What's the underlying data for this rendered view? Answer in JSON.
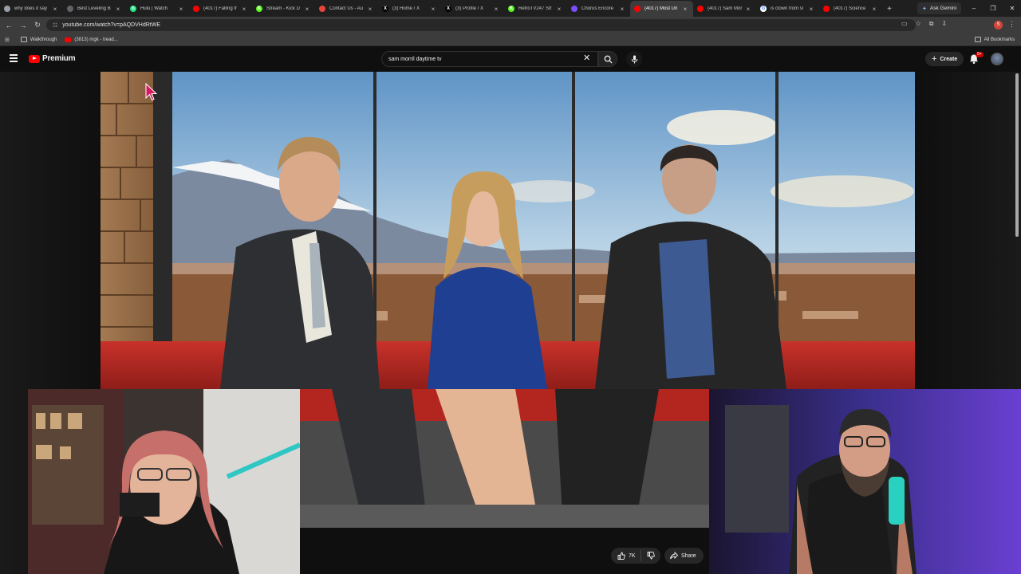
{
  "tabs": [
    {
      "title": "why does it say",
      "favicon_color": "#9aa0a6",
      "favicon_glyph": "",
      "active": false
    },
    {
      "title": "Best Leveling B",
      "favicon_color": "#5f6368",
      "favicon_glyph": "",
      "active": false
    },
    {
      "title": "Hulu | Watch",
      "favicon_color": "#1ce783",
      "favicon_glyph": "h",
      "active": false
    },
    {
      "title": "(4017) Falling fr",
      "favicon_color": "#ff0000",
      "favicon_glyph": "",
      "active": false
    },
    {
      "title": "Stream - Kick D",
      "favicon_color": "#53fc18",
      "favicon_glyph": "K",
      "active": false
    },
    {
      "title": "Contact Us - Au",
      "favicon_color": "#e8453c",
      "favicon_glyph": "",
      "active": false
    },
    {
      "title": "(3) Home / X",
      "favicon_color": "#000000",
      "favicon_glyph": "X",
      "active": false
    },
    {
      "title": "(3) Profile / X",
      "favicon_color": "#000000",
      "favicon_glyph": "X",
      "active": false
    },
    {
      "title": "RetroTV247 Str",
      "favicon_color": "#53fc18",
      "favicon_glyph": "K",
      "active": false
    },
    {
      "title": "Chorus Encore",
      "favicon_color": "#7c4dff",
      "favicon_glyph": "",
      "active": false
    },
    {
      "title": "(4017) Most Un",
      "favicon_color": "#ff0000",
      "favicon_glyph": "",
      "active": true
    },
    {
      "title": "(4017) Sam Mor",
      "favicon_color": "#ff0000",
      "favicon_glyph": "",
      "active": false
    },
    {
      "title": "is clown from sl",
      "favicon_color": "#ffffff",
      "favicon_glyph": "G",
      "active": false
    },
    {
      "title": "(4017) Science",
      "favicon_color": "#ff0000",
      "favicon_glyph": "",
      "active": false
    }
  ],
  "tab_close_glyph": "×",
  "new_tab_glyph": "+",
  "gemini_label": "Ask Gemini",
  "window_controls": {
    "minimize": "–",
    "maximize": "❐",
    "close": "✕"
  },
  "address": {
    "url": "youtube.com/watch?v=pAQDVHdRtWE"
  },
  "profile_initial": "S",
  "bookmarks": {
    "items": [
      {
        "label": "Walkthrough",
        "icon": "folder-icon"
      },
      {
        "label": "(3813) mgk - tread...",
        "icon": "youtube-icon"
      }
    ],
    "all_label": "All Bookmarks"
  },
  "youtube": {
    "logo_text": "Premium",
    "search_value": "sam morril daytime tv",
    "create_label": "Create",
    "notification_count": "9+",
    "actions": {
      "like_count": "7K",
      "share_label": "Share"
    }
  },
  "colors": {
    "youtube_red": "#ff0000",
    "page_bg": "#0f0f0f",
    "chrome_bg": "#3c3c3c"
  }
}
